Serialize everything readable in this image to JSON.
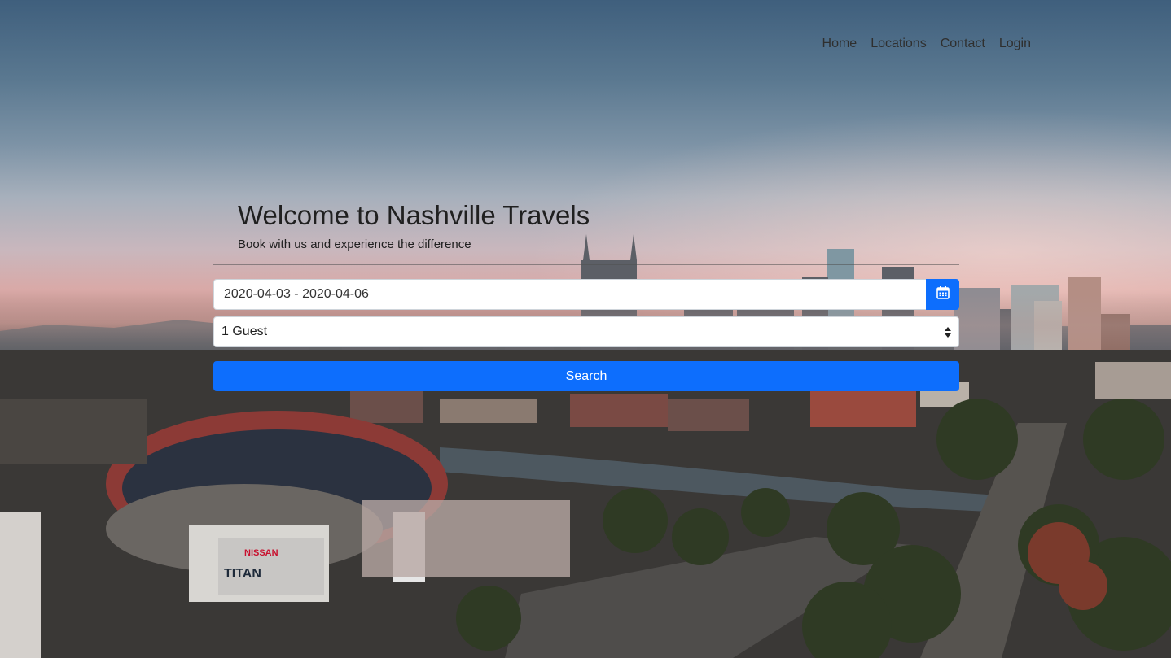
{
  "nav": {
    "items": [
      {
        "label": "Home"
      },
      {
        "label": "Locations"
      },
      {
        "label": "Contact"
      },
      {
        "label": "Login"
      }
    ]
  },
  "hero": {
    "title": "Welcome to Nashville Travels",
    "subtitle": "Book with us and experience the difference"
  },
  "form": {
    "date_range_value": "2020-04-03 - 2020-04-06",
    "calendar_icon": "calendar-icon",
    "guests_selected": "1 Guest",
    "search_label": "Search"
  },
  "colors": {
    "primary": "#0d6efd",
    "text": "#202020"
  }
}
